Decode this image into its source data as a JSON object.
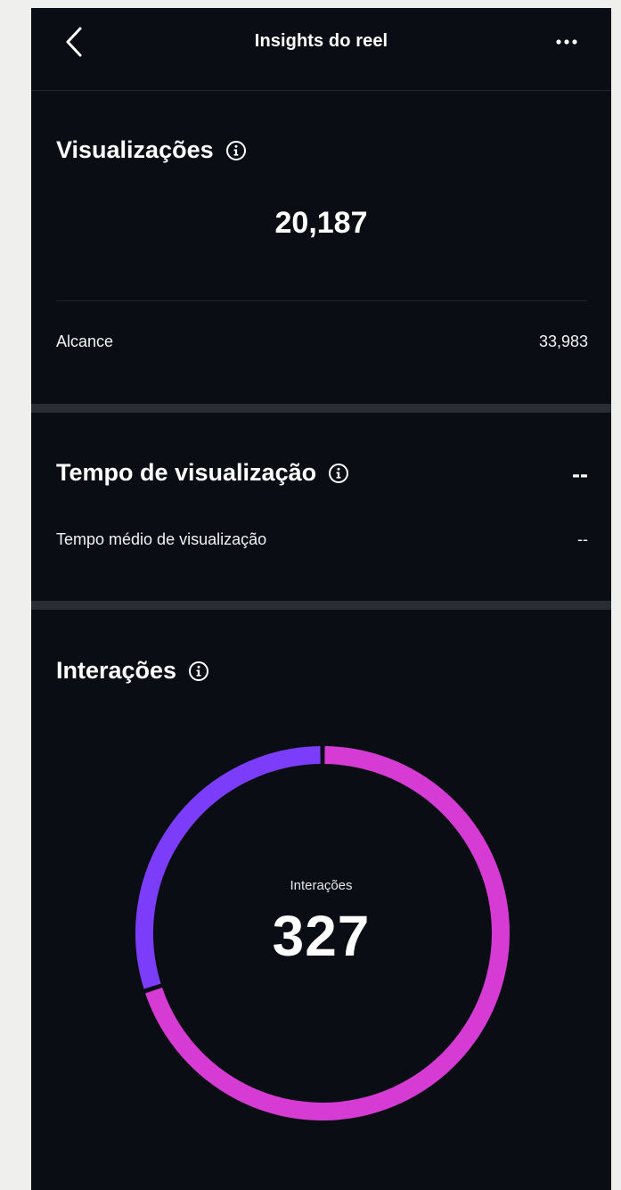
{
  "header": {
    "title": "Insights do reel",
    "back_icon": "chevron-left-icon",
    "more_icon": "more-horizontal-icon"
  },
  "views": {
    "title": "Visualizações",
    "total": "20,187",
    "reach_label": "Alcance",
    "reach_value": "33,983"
  },
  "watch_time": {
    "title": "Tempo de visualização",
    "value": "--",
    "avg_label": "Tempo médio de visualização",
    "avg_value": "--"
  },
  "interactions": {
    "title": "Interações",
    "center_label": "Interações",
    "center_value": "327"
  },
  "colors": {
    "background": "#0b0d14",
    "purple": "#7b3dfa",
    "magenta": "#d63bd4"
  },
  "chart_data": {
    "type": "pie",
    "center_label": "Interações",
    "center_value": 327,
    "slices": [
      {
        "color": "#d63bd4",
        "fraction": 0.7
      },
      {
        "color": "#7b3dfa",
        "fraction": 0.3
      }
    ]
  }
}
